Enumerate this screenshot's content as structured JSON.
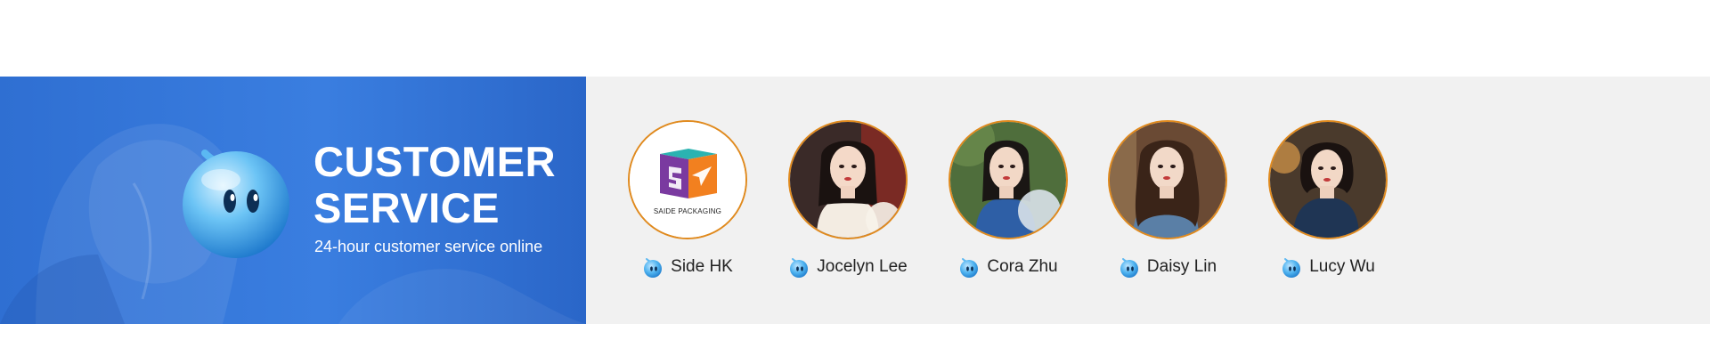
{
  "hero": {
    "title_line1": "CUSTOMER",
    "title_line2": "SERVICE",
    "subtitle": "24-hour customer service online",
    "mascot_icon": "qq-mascot-icon"
  },
  "agents": [
    {
      "name": "Side HK",
      "avatar": "saide-packaging-logo",
      "logo_text": "SAIDE PACKAGING",
      "icon": "qq-chat-icon"
    },
    {
      "name": "Jocelyn Lee",
      "avatar": "agent-photo",
      "icon": "qq-chat-icon"
    },
    {
      "name": "Cora Zhu",
      "avatar": "agent-photo",
      "icon": "qq-chat-icon"
    },
    {
      "name": "Daisy Lin",
      "avatar": "agent-photo",
      "icon": "qq-chat-icon"
    },
    {
      "name": "Lucy Wu",
      "avatar": "agent-photo",
      "icon": "qq-chat-icon"
    }
  ],
  "colors": {
    "hero_blue": "#3a7ee0",
    "panel_gray": "#f1f1f1",
    "avatar_ring": "#e08a1e"
  }
}
